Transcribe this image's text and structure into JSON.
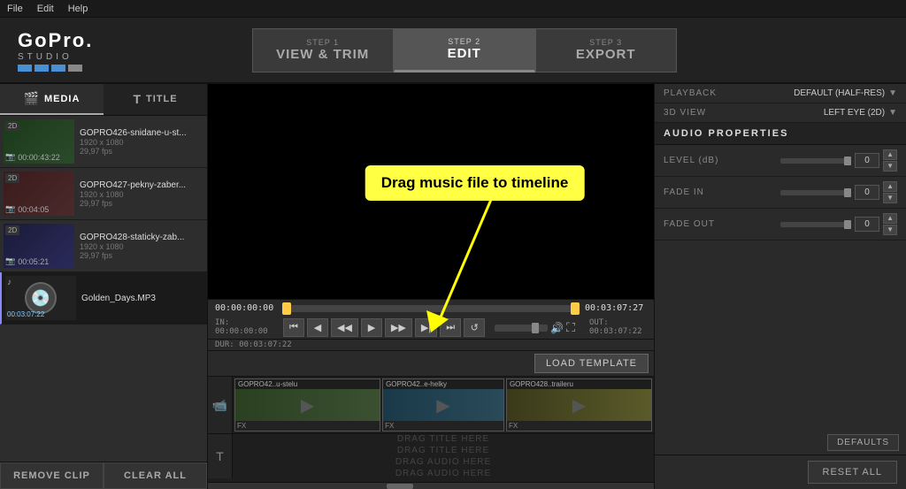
{
  "menubar": {
    "items": [
      "File",
      "Edit",
      "Help"
    ]
  },
  "header": {
    "logo_gopro": "GoPro.",
    "logo_studio": "STUDIO",
    "steps": [
      {
        "num": "STEP 1",
        "label": "VIEW & TRIM",
        "active": false
      },
      {
        "num": "STEP 2",
        "label": "EDIT",
        "active": true
      },
      {
        "num": "STEP 3",
        "label": "EXPORT",
        "active": false
      }
    ]
  },
  "tabs": {
    "media_label": "MEDIA",
    "title_label": "TITLE"
  },
  "media_items": [
    {
      "name": "GOPRO426-snidane-u-st...",
      "meta1": "1920 x 1080",
      "meta2": "00:00:43:22",
      "meta3": "29,97 fps",
      "badge": "2D"
    },
    {
      "name": "GOPRO427-pekny-zaber...",
      "meta1": "1920 x 1080",
      "meta2": "00:04:05",
      "meta3": "29,97 fps",
      "badge": "2D"
    },
    {
      "name": "GOPRO428-staticky-zab...",
      "meta1": "1920 x 1080",
      "meta2": "00:05:21",
      "meta3": "29,97 fps",
      "badge": "2D"
    }
  ],
  "audio_item": {
    "name": "Golden_Days.MP3",
    "duration": "00:03:07:22"
  },
  "bottom_buttons": {
    "remove_clip": "REMOVE CLIP",
    "clear_all": "CLEAR ALL"
  },
  "timeline": {
    "start_time": "00:00:00:00",
    "end_time": "00:03:07:27",
    "in_time": "IN: 00:00:00:00",
    "out_time": "OUT: 00:03:07:22",
    "dur_time": "DUR: 00:03:07:22",
    "load_template": "LOAD TEMPLATE",
    "clips": [
      {
        "label": "GOPRO42..u-stelu",
        "fx": "FX"
      },
      {
        "label": "GOPRO42..e-helky",
        "fx": "FX"
      },
      {
        "label": "GOPRO428..traileru",
        "fx": "FX"
      }
    ],
    "drag_title1": "DRAG TITLE HERE",
    "drag_title2": "DRAG TITLE HERE",
    "drag_audio1": "DRAG AUDIO HERE",
    "drag_audio2": "DRAG AUDIO HERE"
  },
  "tooltip": {
    "text": "Drag music file to timeline"
  },
  "right_panel": {
    "playback_label": "PLAYBACK",
    "playback_value": "DEFAULT (HALF-RES)",
    "view3d_label": "3D VIEW",
    "view3d_value": "LEFT EYE (2D)",
    "audio_props_label": "AUDIO PROPERTIES",
    "level_label": "LEVEL (dB)",
    "level_value": "0",
    "fade_in_label": "FADE IN",
    "fade_in_value": "0",
    "fade_out_label": "FADE OUT",
    "fade_out_value": "0",
    "defaults_btn": "DEFAULTS",
    "reset_all_btn": "RESET ALL"
  }
}
